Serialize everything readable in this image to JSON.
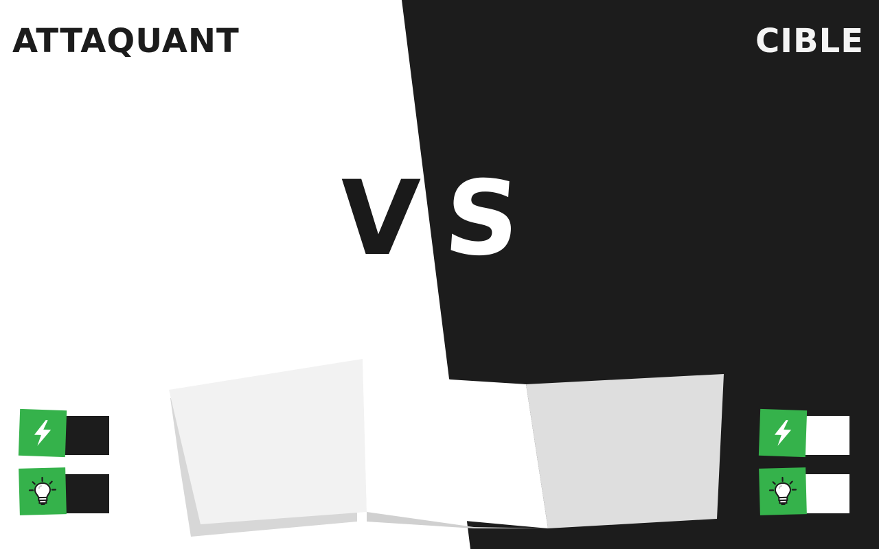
{
  "attacker": {
    "title": "ATTAQUANT",
    "stats": [
      {
        "icon": "lightning-icon"
      },
      {
        "icon": "lightbulb-icon"
      }
    ]
  },
  "target": {
    "title": "CIBLE",
    "stats": [
      {
        "icon": "lightning-icon"
      },
      {
        "icon": "lightbulb-icon"
      }
    ]
  },
  "versus": {
    "v": "V",
    "s": "S"
  },
  "colors": {
    "left_background": "#ffffff",
    "right_background": "#1c1c1c",
    "badge_green": "#35b24b",
    "card_left": "#f2f2f2",
    "card_middle": "#ffffff",
    "card_right": "#dedede"
  }
}
